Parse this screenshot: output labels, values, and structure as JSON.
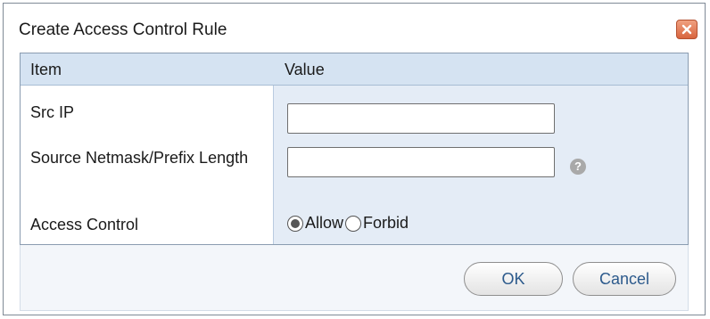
{
  "dialog": {
    "title": "Create Access Control Rule",
    "close_icon": "close-icon"
  },
  "table": {
    "headers": [
      "Item",
      "Value"
    ],
    "rows": [
      {
        "label": "Src IP",
        "type": "text",
        "value": "",
        "placeholder": ""
      },
      {
        "label": "Source Netmask/Prefix Length",
        "type": "text",
        "value": "",
        "placeholder": "",
        "help_icon": "question-mark-icon"
      },
      {
        "label": "Access Control",
        "type": "radio",
        "options": [
          "Allow",
          "Forbid"
        ],
        "selected": "Allow"
      }
    ]
  },
  "footer": {
    "ok_label": "OK",
    "cancel_label": "Cancel"
  },
  "colors": {
    "header_bg": "#d5e3f2",
    "value_col_bg": "#e4ecf6",
    "close_button": "#d8643e",
    "button_text": "#2c5a8c"
  }
}
